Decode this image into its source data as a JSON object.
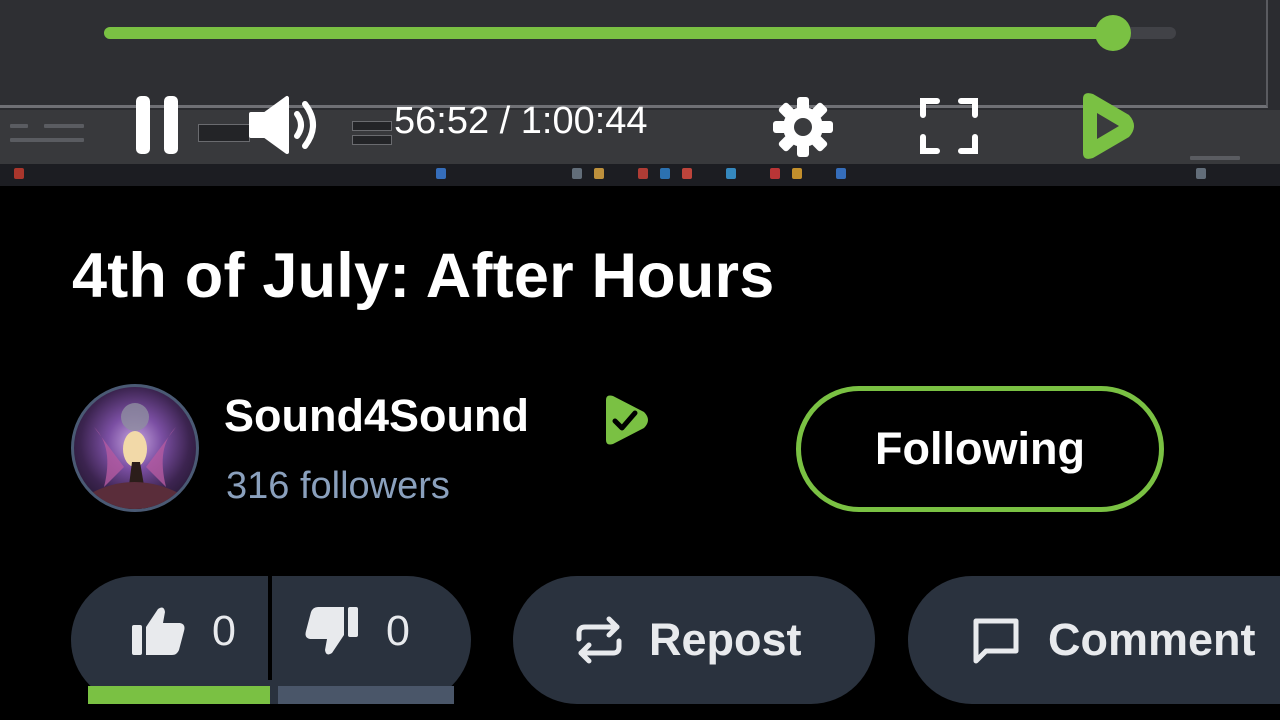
{
  "player": {
    "time_display": "56:52 / 1:00:44",
    "progress_fraction": 0.941,
    "accent_color": "#7ac143",
    "controls": {
      "pause_icon": "pause-icon",
      "volume_icon": "volume-icon",
      "settings_icon": "gear-icon",
      "fullscreen_icon": "fullscreen-icon",
      "logo_icon": "rumble-logo-icon"
    }
  },
  "video": {
    "title": "4th of July: After Hours"
  },
  "channel": {
    "name": "Sound4Sound",
    "verified_icon": "verified-check-icon",
    "followers": "316 followers",
    "follow_button_label": "Following"
  },
  "actions": {
    "likes": "0",
    "dislikes": "0",
    "like_icon": "thumbs-up-icon",
    "dislike_icon": "thumbs-down-icon",
    "repost_label": "Repost",
    "repost_icon": "repost-icon",
    "comment_label": "Comment",
    "comment_icon": "comment-icon",
    "like_bar_color": "#7ac143",
    "dislike_bar_color": "#4a5669"
  }
}
